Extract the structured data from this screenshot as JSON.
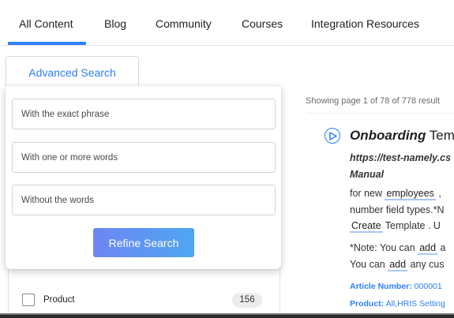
{
  "tabs": [
    {
      "label": "All Content",
      "active": true
    },
    {
      "label": "Blog",
      "active": false
    },
    {
      "label": "Community",
      "active": false
    },
    {
      "label": "Courses",
      "active": false
    },
    {
      "label": "Integration Resources",
      "active": false
    }
  ],
  "advanced_search": {
    "button_label": "Advanced Search",
    "exact_phrase_placeholder": "With the exact phrase",
    "any_words_placeholder": "With one or more words",
    "without_words_placeholder": "Without the words",
    "refine_label": "Refine Search"
  },
  "results": {
    "info": "Showing page 1 of 78 of 778 result",
    "item": {
      "title_em": "Onboarding",
      "title_rest": " Tem",
      "url": "https://test-namely.cs",
      "manual": "Manual",
      "snippet1_pre": "for new ",
      "snippet1_hl": "employees",
      "snippet1_post": " ,",
      "snippet2": "number field types.*N",
      "snippet3_hl": "Create",
      "snippet3_post": " Template .  U",
      "snippet4_pre": "*Note: You can ",
      "snippet4_hl": "add",
      "snippet4_post": " a",
      "snippet5_pre": "You can ",
      "snippet5_hl": "add",
      "snippet5_post": " any cus",
      "article_label": "Article Number:",
      "article_value": " 000001",
      "product_label": "Product:",
      "product_value": " All,HRIS Setting"
    }
  },
  "filters": [
    {
      "label": "Product",
      "count": "156"
    }
  ],
  "colors": {
    "accent": "#2d7ff9",
    "refine_gradient_start": "#6e86f3",
    "refine_gradient_end": "#4ea6f2"
  }
}
